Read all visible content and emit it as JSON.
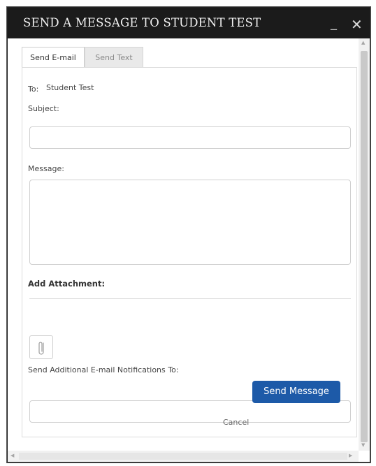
{
  "dialog": {
    "title": "SEND A MESSAGE TO STUDENT TEST",
    "minimize_label": "_",
    "close_label": "✕"
  },
  "tabs": [
    {
      "label": "Send E-mail",
      "active": true
    },
    {
      "label": "Send Text",
      "active": false
    }
  ],
  "form": {
    "to_label": "To:",
    "to_value": "Student Test",
    "subject_label": "Subject:",
    "subject_value": "",
    "message_label": "Message:",
    "message_value": "",
    "attachment_heading": "Add Attachment:",
    "notify_label": "Send Additional E-mail Notifications To:",
    "notify_value": ""
  },
  "actions": {
    "cancel_label": "Cancel",
    "send_label": "Send Message"
  },
  "icons": {
    "attachment": "paperclip-icon"
  },
  "colors": {
    "titlebar": "#1b1b1b",
    "primary_button": "#1d5aa8"
  }
}
